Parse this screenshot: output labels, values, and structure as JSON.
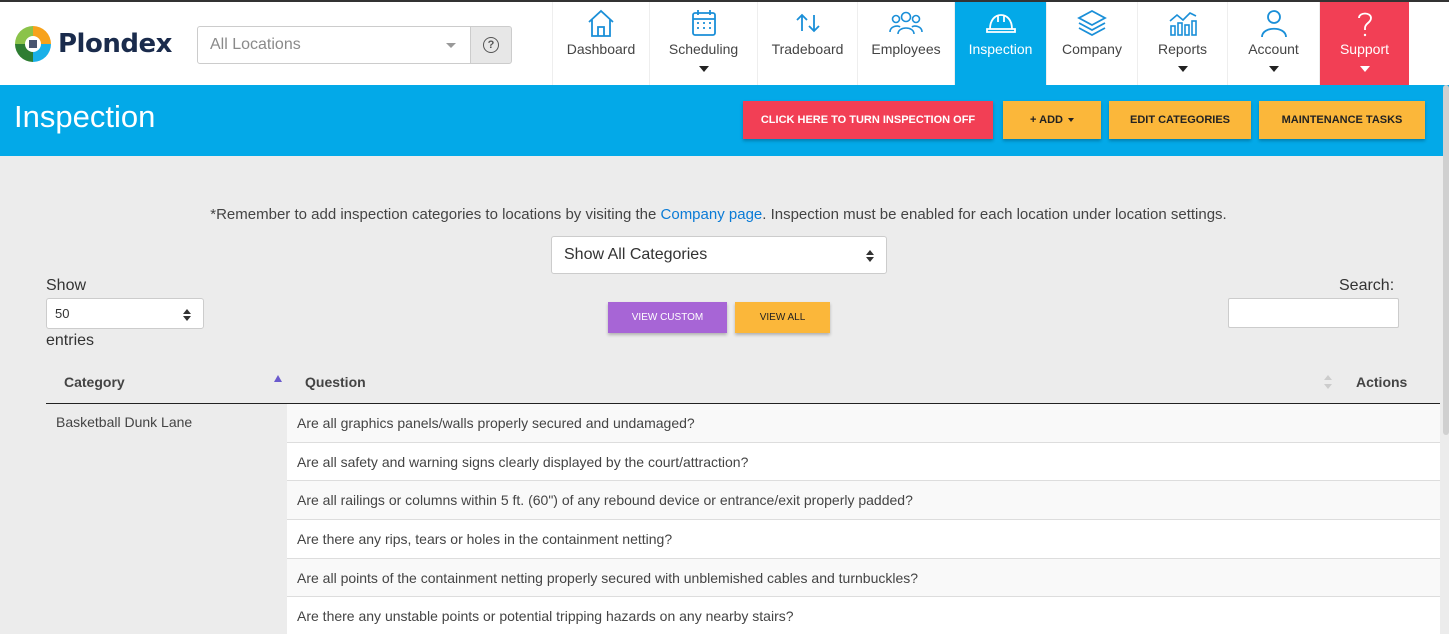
{
  "topbar": {
    "brand": "Plondex",
    "location_select": {
      "value": "All Locations"
    },
    "nav": [
      {
        "label": "Dashboard",
        "icon": "home-icon",
        "dropdown": false,
        "state": "default"
      },
      {
        "label": "Scheduling",
        "icon": "calendar-icon",
        "dropdown": true,
        "state": "default"
      },
      {
        "label": "Tradeboard",
        "icon": "trade-arrows-icon",
        "dropdown": false,
        "state": "default"
      },
      {
        "label": "Employees",
        "icon": "people-icon",
        "dropdown": false,
        "state": "default"
      },
      {
        "label": "Inspection",
        "icon": "hard-hat-icon",
        "dropdown": false,
        "state": "active"
      },
      {
        "label": "Company",
        "icon": "layers-icon",
        "dropdown": false,
        "state": "default"
      },
      {
        "label": "Reports",
        "icon": "chart-icon",
        "dropdown": true,
        "state": "default"
      },
      {
        "label": "Account",
        "icon": "user-icon",
        "dropdown": true,
        "state": "default"
      },
      {
        "label": "Support",
        "icon": "question-icon",
        "dropdown": true,
        "state": "support"
      }
    ]
  },
  "header": {
    "title": "Inspection",
    "turn_off_label": "CLICK HERE TO TURN INSPECTION OFF",
    "add_label": "+ ADD",
    "edit_categories_label": "EDIT CATEGORIES",
    "maintenance_label": "MAINTENANCE TASKS"
  },
  "notice": {
    "before": "*Remember to add inspection categories to locations by visiting the ",
    "link": "Company page",
    "after": ". Inspection must be enabled for each location under location settings."
  },
  "category_filter": {
    "value": "Show All Categories"
  },
  "length": {
    "show_label": "Show",
    "value": "50",
    "entries_label": "entries"
  },
  "view_custom_label": "VIEW CUSTOM",
  "view_all_label": "VIEW ALL",
  "search": {
    "label": "Search:",
    "value": ""
  },
  "table": {
    "headers": {
      "category": "Category",
      "question": "Question",
      "actions": "Actions"
    },
    "category": "Basketball Dunk Lane",
    "rows": [
      "Are all graphics panels/walls properly secured and undamaged?",
      "Are all safety and warning signs clearly displayed by the court/attraction?",
      "Are all railings or columns within 5 ft. (60\") of any rebound device or entrance/exit properly padded?",
      "Are there any rips, tears or holes in the containment netting?",
      "Are all points of the containment netting properly secured with unblemished cables and turnbuckles?",
      "Are there any unstable points or potential tripping hazards on any nearby stairs?"
    ]
  },
  "colors": {
    "primary_blue": "#03a9e8",
    "alert_red": "#f23f55",
    "button_yellow": "#fbb73a",
    "custom_purple": "#a765d6",
    "link_blue": "#0a7bd6"
  }
}
